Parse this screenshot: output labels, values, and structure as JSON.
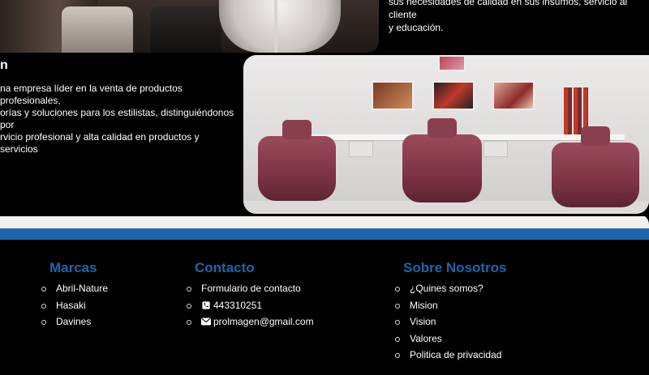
{
  "top": {
    "text_line1": "sus necesidades de calidad en sus insumos, servicio al cliente",
    "text_line2": "y educación."
  },
  "about": {
    "title_fragment": "n",
    "lines": [
      "na empresa líder en la venta de productos profesionales,",
      "orías y soluciones para los estilistas, distinguiéndonos por",
      "rvicio profesional y alta calidad en productos y servicios"
    ]
  },
  "colors": {
    "accent": "#1f65ad",
    "background": "#000000",
    "band": "#f2f0ef"
  },
  "footer": {
    "marcas": {
      "title": "Marcas",
      "items": [
        "Abril-Nature",
        "Hasaki",
        "Davines"
      ]
    },
    "contacto": {
      "title": "Contacto",
      "form": "Formulario de contacto",
      "phone": "443310251",
      "phone_icon": "phone-icon",
      "email": "prolmagen@gmail.com",
      "email_icon": "envelope-icon"
    },
    "sobre": {
      "title": "Sobre Nosotros",
      "items": [
        "¿Quines somos?",
        "Mision",
        "Vision",
        "Valores",
        "Politica de privacidad"
      ]
    }
  }
}
